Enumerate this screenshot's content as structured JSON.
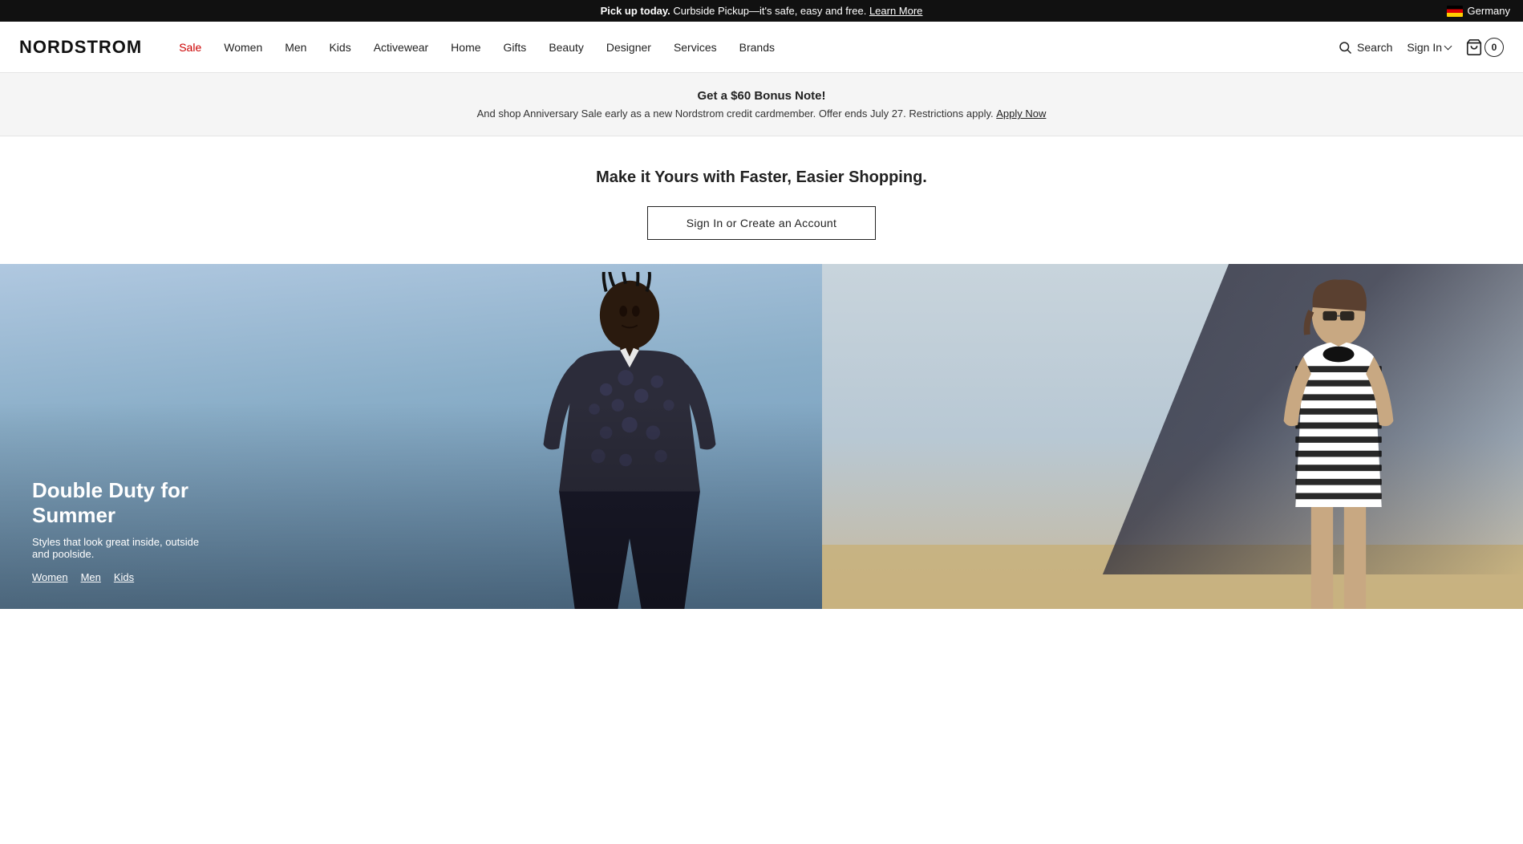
{
  "topBar": {
    "message_bold": "Pick up today.",
    "message_text": " Curbside Pickup—it's safe, easy and free.",
    "link_text": "Learn More",
    "country": "Germany"
  },
  "header": {
    "logo": "NORDSTROM",
    "nav_items": [
      {
        "id": "sale",
        "label": "Sale",
        "sale": true
      },
      {
        "id": "women",
        "label": "Women",
        "sale": false
      },
      {
        "id": "men",
        "label": "Men",
        "sale": false
      },
      {
        "id": "kids",
        "label": "Kids",
        "sale": false
      },
      {
        "id": "activewear",
        "label": "Activewear",
        "sale": false
      },
      {
        "id": "home",
        "label": "Home",
        "sale": false
      },
      {
        "id": "gifts",
        "label": "Gifts",
        "sale": false
      },
      {
        "id": "beauty",
        "label": "Beauty",
        "sale": false
      },
      {
        "id": "designer",
        "label": "Designer",
        "sale": false
      },
      {
        "id": "services",
        "label": "Services",
        "sale": false
      },
      {
        "id": "brands",
        "label": "Brands",
        "sale": false
      }
    ],
    "search_label": "Search",
    "signin_label": "Sign In",
    "cart_count": "0"
  },
  "promoBanner": {
    "headline": "Get a $60 Bonus Note!",
    "subtext": "And shop Anniversary Sale early as a new Nordstrom credit cardmember. Offer ends July 27. Restrictions apply.",
    "link_text": "Apply Now"
  },
  "signinSection": {
    "heading": "Make it Yours with Faster, Easier Shopping.",
    "cta_label": "Sign In or Create an Account"
  },
  "hero": {
    "left": {
      "title_line1": "Double Duty for",
      "title_line2": "Summer",
      "description": "Styles that look great inside, outside and poolside.",
      "links": [
        {
          "label": "Women",
          "id": "women"
        },
        {
          "label": "Men",
          "id": "men"
        },
        {
          "label": "Kids",
          "id": "kids"
        }
      ]
    }
  }
}
